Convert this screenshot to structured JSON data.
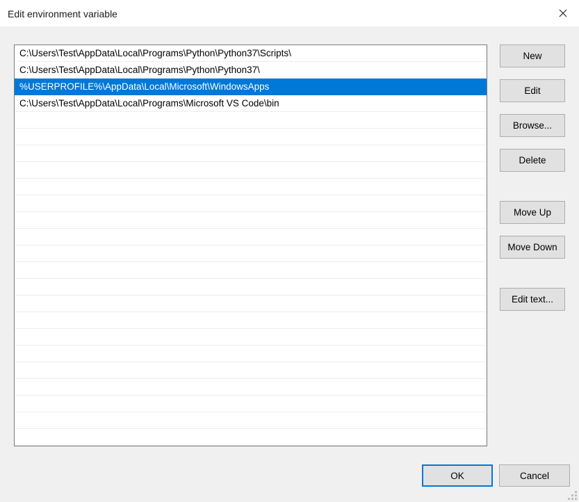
{
  "window": {
    "title": "Edit environment variable",
    "close_icon": "close-icon"
  },
  "path_list": {
    "entries": [
      "C:\\Users\\Test\\AppData\\Local\\Programs\\Python\\Python37\\Scripts\\",
      "C:\\Users\\Test\\AppData\\Local\\Programs\\Python\\Python37\\",
      "%USERPROFILE%\\AppData\\Local\\Microsoft\\WindowsApps",
      "C:\\Users\\Test\\AppData\\Local\\Programs\\Microsoft VS Code\\bin"
    ],
    "selected_index": 2,
    "empty_row_count": 20,
    "selection_color": "#0078d7"
  },
  "side_buttons": [
    {
      "id": "btn-new",
      "name": "new-button",
      "label": "New"
    },
    {
      "id": "btn-edit",
      "name": "edit-button",
      "label": "Edit"
    },
    {
      "id": "btn-browse",
      "name": "browse-button",
      "label": "Browse..."
    },
    {
      "id": "btn-delete",
      "name": "delete-button",
      "label": "Delete"
    },
    {
      "id": "btn-moveup",
      "name": "move-up-button",
      "label": "Move Up"
    },
    {
      "id": "btn-movedown",
      "name": "move-down-button",
      "label": "Move Down"
    },
    {
      "id": "btn-edittext",
      "name": "edit-text-button",
      "label": "Edit text..."
    }
  ],
  "bottom_buttons": {
    "ok_label": "OK",
    "cancel_label": "Cancel",
    "default_button": "OK",
    "focus_color": "#0078d7"
  }
}
